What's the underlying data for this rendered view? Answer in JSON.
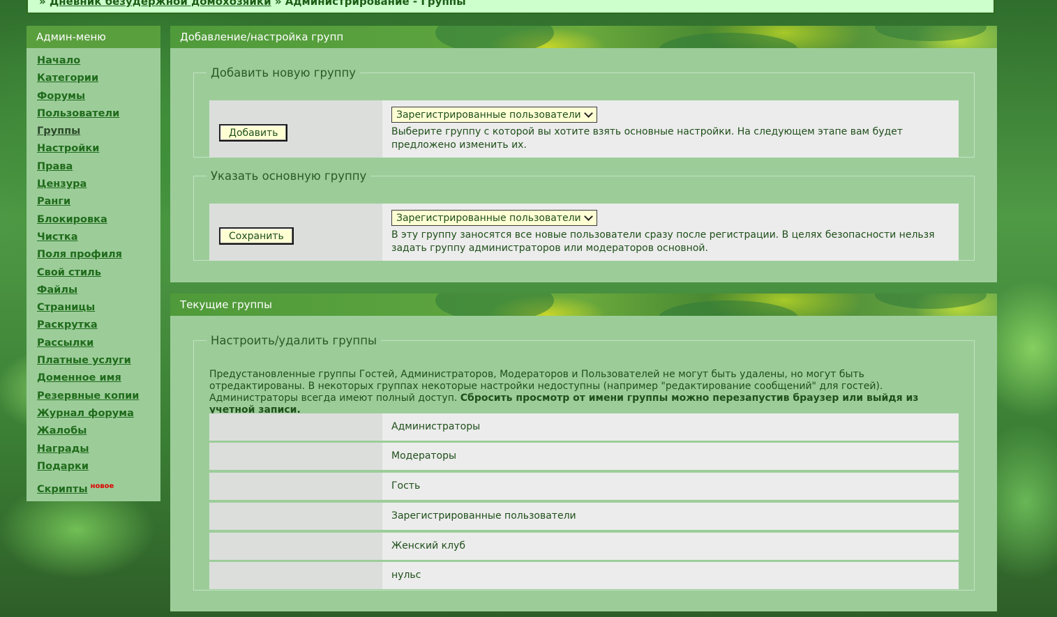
{
  "breadcrumb": {
    "separator": "»",
    "forum_link": "Дневник безудержной домохозяйки",
    "current": "Администрирование - Группы"
  },
  "sidebar": {
    "title": "Админ-меню",
    "items": [
      {
        "label": "Начало"
      },
      {
        "label": "Категории"
      },
      {
        "label": "Форумы"
      },
      {
        "label": "Пользователи"
      },
      {
        "label": "Группы"
      },
      {
        "label": "Настройки"
      },
      {
        "label": "Права"
      },
      {
        "label": "Цензура"
      },
      {
        "label": "Ранги"
      },
      {
        "label": "Блокировка"
      },
      {
        "label": "Чистка"
      },
      {
        "label": "Поля профиля"
      },
      {
        "label": "Свой стиль"
      },
      {
        "label": "Файлы"
      },
      {
        "label": "Страницы"
      },
      {
        "label": "Раскрутка"
      },
      {
        "label": "Рассылки"
      },
      {
        "label": "Платные услуги"
      },
      {
        "label": "Доменное имя"
      },
      {
        "label": "Резервные копии"
      },
      {
        "label": "Журнал форума"
      },
      {
        "label": "Жалобы"
      },
      {
        "label": "Награды"
      },
      {
        "label": "Подарки"
      },
      {
        "label": "Скрипты",
        "badge": "новое"
      }
    ]
  },
  "add_panel": {
    "title": "Добавление/настройка групп",
    "add_group": {
      "legend": "Добавить новую группу",
      "button": "Добавить",
      "select_value": "Зарегистрированные пользователи",
      "description": "Выберите группу с которой вы хотите взять основные настройки. На следующем этапе вам будет предложено изменить их."
    },
    "default_group": {
      "legend": "Указать основную группу",
      "button": "Сохранить",
      "select_value": "Зарегистрированные пользователи",
      "description": "В эту группу заносятся все новые пользователи сразу после регистрации. В целях безопасности нельзя задать группу администраторов или модераторов основной."
    }
  },
  "groups_panel": {
    "title": "Текущие группы",
    "legend": "Настроить/удалить группы",
    "info": "Предустановленные группы Гостей, Администраторов, Модераторов и Пользователей не могут быть удалены, но могут быть отредактированы. В некоторых группах некоторые настройки недоступны (например \"редактирование сообщений\" для гостей). Администраторы всегда имеют полный доступ.",
    "info_bold": "Сбросить просмотр от имени группы можно перезапустив браузер или выйдя из учетной записи.",
    "groups": [
      {
        "name": "Администраторы"
      },
      {
        "name": "Модераторы"
      },
      {
        "name": "Гость"
      },
      {
        "name": "Зарегистрированные пользователи"
      },
      {
        "name": "Женский клуб"
      },
      {
        "name": "нульс"
      }
    ]
  }
}
